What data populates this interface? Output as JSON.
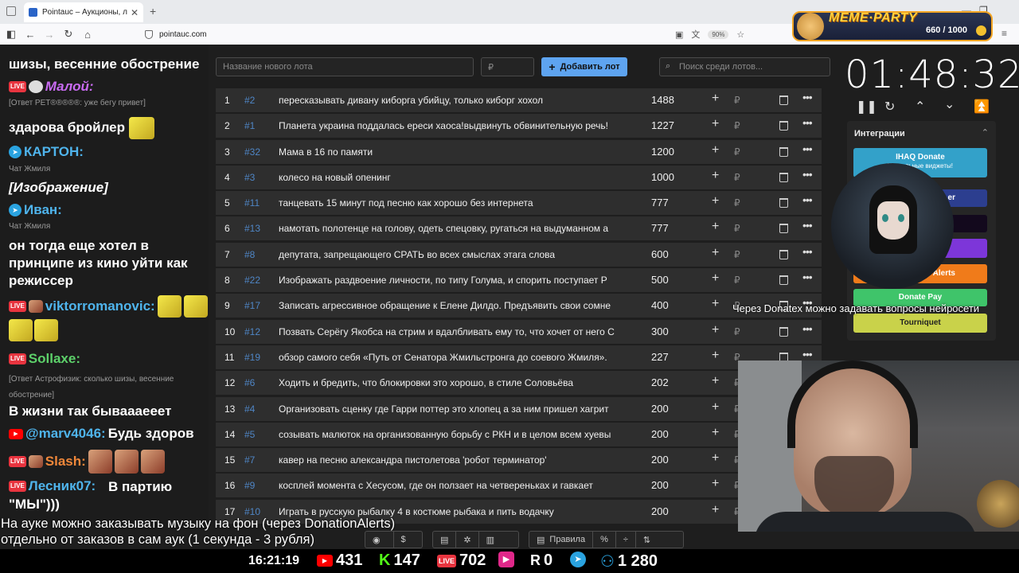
{
  "browser": {
    "tab_title": "Pointauc – Аукционы, лотереи",
    "url": "pointauc.com",
    "zoom": "90%"
  },
  "meme": {
    "title": "MEME·PARTY",
    "count": "660 / 1000"
  },
  "chat": {
    "line1": "шизы, весенние обострение",
    "m1_name": "Малой:",
    "m1_reply": "[Ответ РЕТ®®®®®: уже бегу привет]",
    "m1_text": "здарова бройлер",
    "m2_name": "КАРТОН:",
    "m2_sub": "Чат Жмиля",
    "m2_text": "[Изображение]",
    "m3_name": "Иван:",
    "m3_sub": "Чат Жмиля",
    "m3_text": "он тогда еще хотел в принципе из кино уйти как режиссер",
    "m4_name": "viktorromanovic:",
    "m5_name": "Sollaxe:",
    "m5_reply": "[Ответ Астрофизик: сколько шизы, весенние обострение]",
    "m5_text": "В жизни так бываааееет",
    "m6_name": "@marv4046:",
    "m6_text": "Будь здоров",
    "m7_name": "Slash:",
    "m8_name": "Лесник07:",
    "m8_text": "В партию \"МЫ\")))"
  },
  "controls": {
    "lot_placeholder": "Название нового лота",
    "amount_placeholder": "₽",
    "add_label": "Добавить лот",
    "search_placeholder": "Поиск среди лотов..."
  },
  "lots": [
    {
      "n": "1",
      "id": "#2",
      "name": "пересказывать дивану киборга убийцу, только киборг хохол",
      "amount": "1488"
    },
    {
      "n": "2",
      "id": "#1",
      "name": "Планета украина поддалась ереси хаоса!выдвинуть обвинительную речь!",
      "amount": "1227"
    },
    {
      "n": "3",
      "id": "#32",
      "name": "Мама в 16 по памяти",
      "amount": "1200"
    },
    {
      "n": "4",
      "id": "#3",
      "name": "колесо на новый опенинг",
      "amount": "1000"
    },
    {
      "n": "5",
      "id": "#11",
      "name": "танцевать 15 минут под песню как хорошо без интернета",
      "amount": "777"
    },
    {
      "n": "6",
      "id": "#13",
      "name": "намотать полотенце на голову, одеть спецовку, ругаться на выдуманном а",
      "amount": "777"
    },
    {
      "n": "7",
      "id": "#8",
      "name": "депутата, запрещающего СРАТЬ во всех смыслах этага слова",
      "amount": "600"
    },
    {
      "n": "8",
      "id": "#22",
      "name": "Изображать раздвоение личности, по типу Голума, и спорить поступает Р",
      "amount": "500"
    },
    {
      "n": "9",
      "id": "#17",
      "name": "Записать агрессивное обращение к Елене Дилдо. Предъявить свои сомне",
      "amount": "400"
    },
    {
      "n": "10",
      "id": "#12",
      "name": "Позвать Серёгу Якобса на стрим и вдалбливать ему то, что хочет от него С",
      "amount": "300"
    },
    {
      "n": "11",
      "id": "#19",
      "name": "обзор самого себя «Путь от Сенатора Жмильстронга до соевого Жмиля».",
      "amount": "227"
    },
    {
      "n": "12",
      "id": "#6",
      "name": "Ходить и бредить, что блокировки это хорошо, в стиле Соловьёва",
      "amount": "202"
    },
    {
      "n": "13",
      "id": "#4",
      "name": "Организовать сценку где Гарри поттер это хлопец а за ним пришел хагрит",
      "amount": "200"
    },
    {
      "n": "14",
      "id": "#5",
      "name": "созывать малюток на организованную борьбу с РКН и в целом всем хуевы",
      "amount": "200"
    },
    {
      "n": "15",
      "id": "#7",
      "name": "кавер на песню александра пистолетова 'робот терминатор'",
      "amount": "200"
    },
    {
      "n": "16",
      "id": "#9",
      "name": "косплей момента с Хесусом, где он ползает на четвереньках и гавкает",
      "amount": "200"
    },
    {
      "n": "17",
      "id": "#10",
      "name": "Играть в русскую рыбалку 4 в костюме рыбака и пить водачку",
      "amount": "200"
    }
  ],
  "timer": {
    "value": "01:48:32"
  },
  "integrations": {
    "title": "Интеграции",
    "ihaq": "IHAQ Donate",
    "ihaq_sub": "Уникальные виджеты!",
    "alerts": "Alerts",
    "donatepay": "Donate Pay",
    "tourniquet": "Tourniquet",
    "partial": "er"
  },
  "ticker": "Через Donatex можно задавать вопросы нейросети",
  "bottom": {
    "line1": "На ауке можно заказывать музыку на фон (через DonationAlerts)",
    "line2": "отдельно от заказов в сам аук (1 секунда - 3 рубля)",
    "rules": "Правила"
  },
  "stats": {
    "clock": "16:21:19",
    "youtube": "431",
    "kick": "147",
    "live": "702",
    "r": "0",
    "total": "1 280"
  },
  "colors": {
    "accent": "#5ea4f0",
    "lot_id": "#4f86c6",
    "row_bg": "#2e2e2e"
  }
}
